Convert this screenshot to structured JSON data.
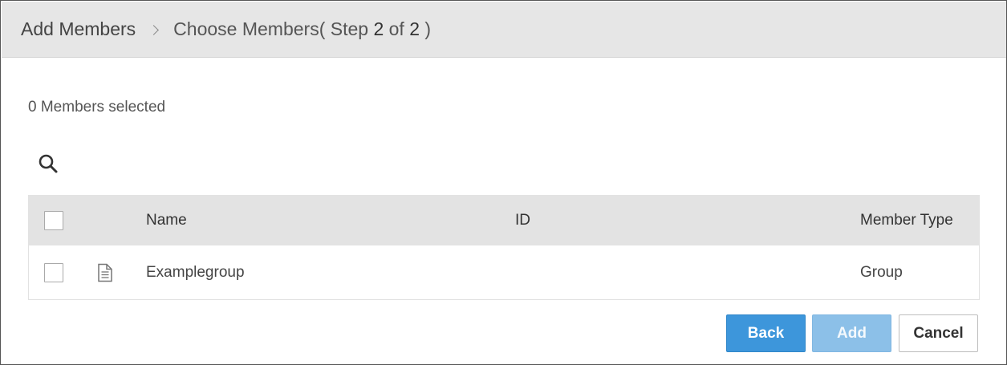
{
  "breadcrumb": {
    "root": "Add Members",
    "current_prefix": "Choose Members( Step ",
    "step": "2",
    "of_word": " of ",
    "total": "2",
    "current_suffix": " )"
  },
  "selection": {
    "count_text": "0 Members selected"
  },
  "search": {
    "icon": "search-icon"
  },
  "table": {
    "headers": {
      "name": "Name",
      "id": "ID",
      "member_type": "Member Type"
    },
    "rows": [
      {
        "icon": "document-icon",
        "name": "Examplegroup",
        "id": "",
        "member_type": "Group"
      }
    ]
  },
  "buttons": {
    "back": "Back",
    "add": "Add",
    "cancel": "Cancel"
  },
  "colors": {
    "primary": "#3d96db",
    "primary_disabled": "#8cc0e8",
    "header_bg": "#e6e6e6",
    "table_header_bg": "#e3e3e3"
  }
}
